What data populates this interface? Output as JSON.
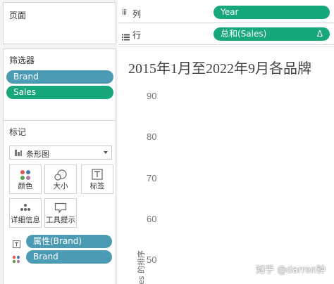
{
  "pages": {
    "title": "页面"
  },
  "filters": {
    "title": "筛选器",
    "items": [
      "Brand",
      "Sales"
    ]
  },
  "marks": {
    "title": "标记",
    "mark_type": "条形图",
    "buttons": [
      "颜色",
      "大小",
      "标签",
      "详细信息",
      "工具提示"
    ],
    "fields": [
      "属性(Brand)",
      "Brand"
    ]
  },
  "columns_shelf": {
    "icon": "iii",
    "label": "列",
    "pill": "Year"
  },
  "rows_shelf": {
    "label": "行",
    "pill": "总和(Sales)",
    "pill_icon": "Δ"
  },
  "chart": {
    "title": "2015年1月至2022年9月各品牌",
    "yticks": [
      "90",
      "80",
      "70",
      "60",
      "50"
    ],
    "ylabel": "es 的排序"
  },
  "watermark": "知乎 @darren钟",
  "colors": {
    "pill_blue": "#4b9bb5",
    "pill_green": "#16a77b"
  }
}
